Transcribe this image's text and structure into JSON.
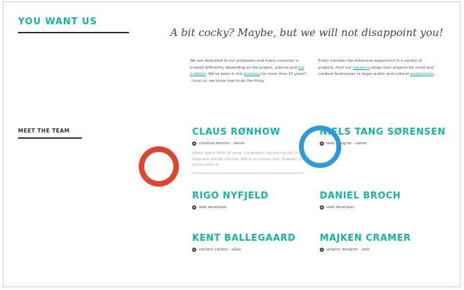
{
  "header": {
    "title": "YOU WANT US",
    "tagline": "A bit cocky? Maybe, but we will not disappoint you!"
  },
  "intro": {
    "paragraph_1": {
      "before": "We are dedicated to our profession and every customer is treated differently depending on the project, volume and ",
      "link": "the tradition",
      "middle": ". We've been in this ",
      "link2": "business",
      "after": " for more than 10 years* - trust us, we know how to do the thing."
    },
    "paragraph_2": {
      "before": "Every member has extensive experience in a variety of projects, from our ",
      "link": "solutions",
      "middle": " range from projects for small and medium businesses to larger public and cultural ",
      "link2": "assignments",
      "after": "."
    }
  },
  "team": {
    "title": "MEET THE TEAM",
    "members": [
      {
        "name": "CLAUS RØNHOW",
        "role": "creative director · owner",
        "bio": "Lorem ipsum dolor sit amet, consectetur adi piscing elit. In vulputate blandit ultricies. Sed in accumsan felis. Praesent id luctus lorem et."
      },
      {
        "name": "NIELS TANG SØRENSEN",
        "role": "web designer · owner"
      },
      {
        "name": "RIGO NYFJELD",
        "role": "web developer"
      },
      {
        "name": "DANIEL BROCH",
        "role": "web developer"
      },
      {
        "name": "KENT BALLEGAARD",
        "role": "content creator · sales"
      },
      {
        "name": "MAJKEN CRAMER",
        "role": "graphic designer · web"
      }
    ]
  },
  "annotations": {
    "red_marker_color": "#e0452f",
    "blue_marker_color": "#2e9bd6"
  },
  "colors": {
    "accent": "#12b5a8",
    "text": "#333333"
  }
}
